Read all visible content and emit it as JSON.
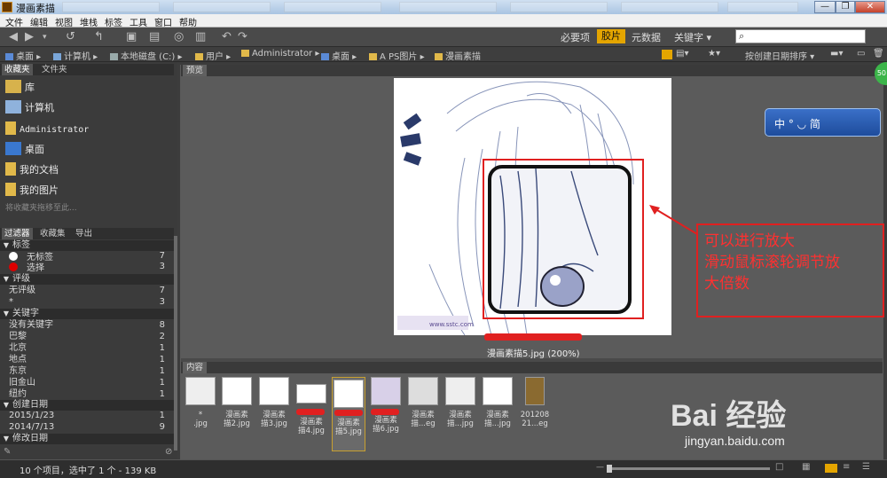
{
  "window": {
    "title": "漫画素描",
    "controls": [
      "—",
      "❐",
      "✕"
    ]
  },
  "menu": [
    "文件",
    "编辑",
    "视图",
    "堆栈",
    "标签",
    "工具",
    "窗口",
    "帮助"
  ],
  "workspaces": [
    "必要项",
    "胶片",
    "元数据",
    "关键字 ▾"
  ],
  "search": {
    "placeholder": ""
  },
  "path": [
    "桌面",
    "计算机",
    "本地磁盘 (C:)",
    "用户",
    "Administrator",
    "桌面",
    "A PS图片",
    "漫画素描"
  ],
  "sort_label": "按创建日期排序 ▾",
  "left": {
    "tabs": [
      "收藏夹",
      "文件夹"
    ],
    "favorites": [
      "库",
      "计算机",
      "Administrator",
      "桌面",
      "我的文档",
      "我的图片"
    ],
    "drag_hint": "将收藏夹拖移至此...",
    "filter_tabs": [
      "过滤器",
      "收藏集",
      "导出"
    ],
    "filter_sections": [
      {
        "title": "标签",
        "rows": [
          {
            "label": "无标签",
            "count": "7"
          },
          {
            "label": "选择",
            "count": "3"
          }
        ]
      },
      {
        "title": "评级",
        "rows": [
          {
            "label": "无评级",
            "count": "7"
          },
          {
            "label": "*",
            "count": "3"
          }
        ]
      },
      {
        "title": "关键字",
        "rows": [
          {
            "label": "没有关键字",
            "count": "8"
          },
          {
            "label": "巴黎",
            "count": "2"
          },
          {
            "label": "北京",
            "count": "1"
          },
          {
            "label": "地点",
            "count": "1"
          },
          {
            "label": "东京",
            "count": "1"
          },
          {
            "label": "旧金山",
            "count": "1"
          },
          {
            "label": "纽约",
            "count": "1"
          }
        ]
      },
      {
        "title": "创建日期",
        "rows": [
          {
            "label": "2015/1/23",
            "count": "1"
          },
          {
            "label": "2014/7/13",
            "count": "9"
          }
        ]
      },
      {
        "title": "修改日期",
        "rows": []
      }
    ]
  },
  "preview": {
    "tab": "预览",
    "caption": "漫画素描5.jpg (200%)",
    "watermark": "www.sstc.com"
  },
  "annotation": {
    "line1": "可以进行放大",
    "line2": "滑动鼠标滚轮调节放",
    "line3": "大倍数"
  },
  "ime": {
    "label": "中 ° ◡ 简"
  },
  "badge": "50",
  "content": {
    "tab": "内容",
    "thumbs": [
      {
        "cap": "*\n.jpg"
      },
      {
        "cap": "漫画素\n描2.jpg"
      },
      {
        "cap": "漫画素\n描3.jpg"
      },
      {
        "cap": "漫画素\n描4.jpg"
      },
      {
        "cap": "漫画素\n描5.jpg"
      },
      {
        "cap": "漫画素\n描6.jpg"
      },
      {
        "cap": "漫画素\n描...eg"
      },
      {
        "cap": "漫画素\n描...jpg"
      },
      {
        "cap": "漫画素\n描...jpg"
      },
      {
        "cap": "201208\n21...eg"
      }
    ]
  },
  "status": {
    "text": "10 个项目，选中了 1 个 - 139 KB"
  },
  "baidu": {
    "logo": "Bai 经验",
    "url": "jingyan.baidu.com"
  }
}
